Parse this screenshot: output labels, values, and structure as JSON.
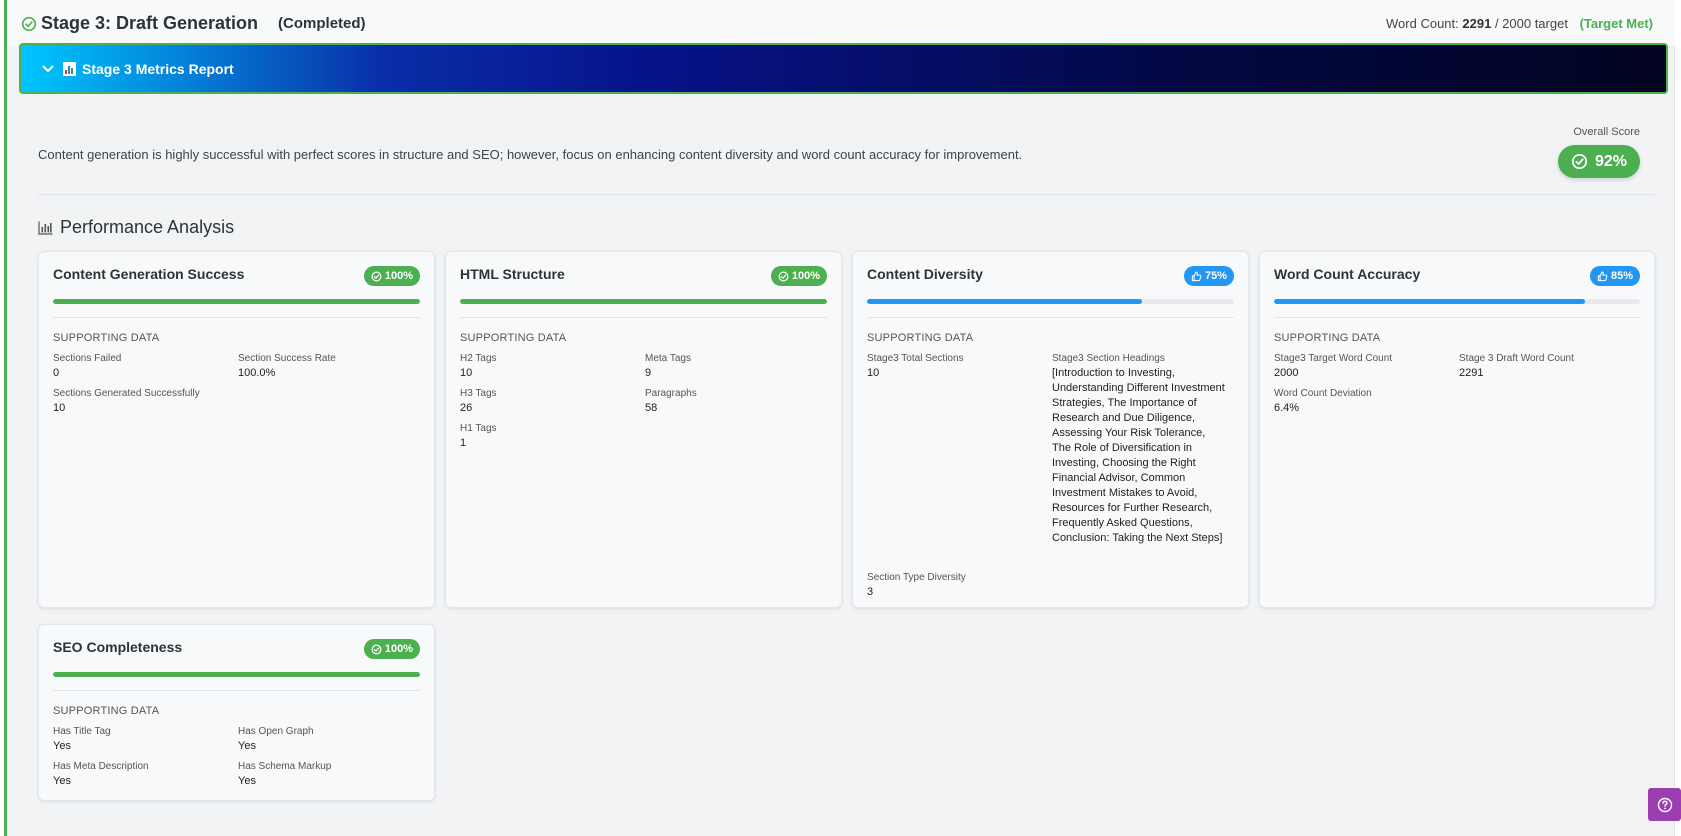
{
  "header": {
    "title": "Stage 3: Draft Generation",
    "status": "(Completed)",
    "word_count_label": "Word Count:",
    "word_count_value": "2291",
    "word_count_target": "/ 2000 target",
    "target_status": "(Target Met)"
  },
  "banner": {
    "title": "Stage 3 Metrics Report"
  },
  "summary": {
    "text": "Content generation is highly successful with perfect scores in structure and SEO; however, focus on enhancing content diversity and word count accuracy for improvement.",
    "overall_label": "Overall Score",
    "overall_score": "92%"
  },
  "performance": {
    "title": "Performance Analysis",
    "supporting_label": "SUPPORTING DATA",
    "cards": [
      {
        "title": "Content Generation Success",
        "score": "100%",
        "progress": 1.0,
        "color": "#4caf50",
        "icon": "check-circle-icon",
        "fields": [
          {
            "label": "Sections Failed",
            "value": "0"
          },
          {
            "label": "Section Success Rate",
            "value": "100.0%"
          },
          {
            "label": "Sections Generated Successfully",
            "value": "10"
          }
        ]
      },
      {
        "title": "HTML Structure",
        "score": "100%",
        "progress": 1.0,
        "color": "#4caf50",
        "icon": "check-circle-icon",
        "fields": [
          {
            "label": "H2 Tags",
            "value": "10"
          },
          {
            "label": "Meta Tags",
            "value": "9"
          },
          {
            "label": "H3 Tags",
            "value": "26"
          },
          {
            "label": "Paragraphs",
            "value": "58"
          },
          {
            "label": "H1 Tags",
            "value": "1"
          }
        ]
      },
      {
        "title": "Content Diversity",
        "score": "75%",
        "progress": 0.75,
        "color": "#2196f3",
        "icon": "thumbs-up-icon",
        "fields": [
          {
            "label": "Stage3 Total Sections",
            "value": "10"
          },
          {
            "label": "Stage3 Section Headings",
            "value": "[Introduction to Investing, Understanding Different Investment Strategies, The Importance of Research and Due Diligence, Assessing Your Risk Tolerance, The Role of Diversification in Investing, Choosing the Right Financial Advisor, Common Investment Mistakes to Avoid, Resources for Further Research, Frequently Asked Questions, Conclusion: Taking the Next Steps]"
          },
          {
            "label": "Section Type Diversity",
            "value": "3"
          }
        ]
      },
      {
        "title": "Word Count Accuracy",
        "score": "85%",
        "progress": 0.85,
        "color": "#2196f3",
        "icon": "thumbs-up-icon",
        "fields": [
          {
            "label": "Stage3 Target Word Count",
            "value": "2000"
          },
          {
            "label": "Stage 3 Draft Word Count",
            "value": "2291"
          },
          {
            "label": "Word Count Deviation",
            "value": "6.4%"
          }
        ]
      },
      {
        "title": "SEO Completeness",
        "score": "100%",
        "progress": 1.0,
        "color": "#4caf50",
        "icon": "check-circle-icon",
        "fields": [
          {
            "label": "Has Title Tag",
            "value": "Yes"
          },
          {
            "label": "Has Open Graph",
            "value": "Yes"
          },
          {
            "label": "Has Meta Description",
            "value": "Yes"
          },
          {
            "label": "Has Schema Markup",
            "value": "Yes"
          }
        ]
      }
    ]
  },
  "help": {
    "icon": "help-icon"
  }
}
